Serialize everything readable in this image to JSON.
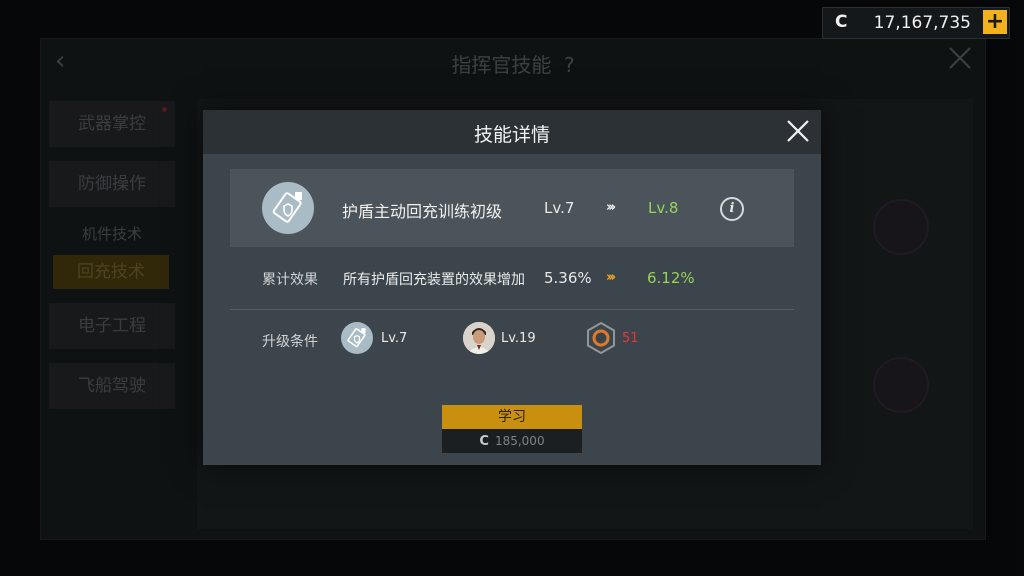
{
  "currency": {
    "icon": "C",
    "amount": "17,167,735",
    "add": "+"
  },
  "background": {
    "title": "指挥官技能",
    "help": "?",
    "menu": [
      "武器掌控",
      "防御操作",
      "机件技术",
      "回充技术",
      "电子工程",
      "飞船驾驶"
    ]
  },
  "dialog": {
    "title": "技能详情",
    "skill": {
      "icon": "shield-recharge-icon",
      "name": "护盾主动回充训练初级",
      "level_current": "Lv.7",
      "level_next": "Lv.8"
    },
    "effect": {
      "label": "累计效果",
      "description": "所有护盾回充装置的效果增加",
      "value_current": "5.36%",
      "value_next": "6.12%"
    },
    "requirements": {
      "label": "升级条件",
      "skill_level": "Lv.7",
      "commander_level": "Lv.19",
      "resource_amount": "51"
    },
    "learn_button": {
      "label": "学习",
      "cost_icon": "C",
      "cost": "185,000"
    }
  },
  "colors": {
    "accent": "#f2b21c",
    "upgrade_green": "#9ad35a",
    "insufficient_red": "#e0393a"
  }
}
